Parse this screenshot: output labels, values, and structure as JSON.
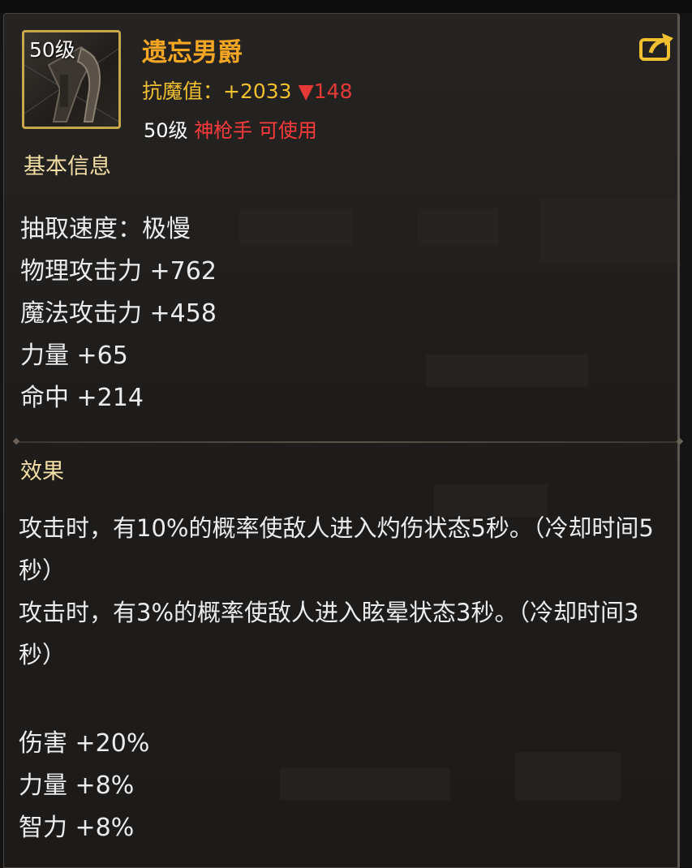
{
  "item": {
    "level_badge": "50级",
    "name": "遗忘男爵",
    "stat_label": "抗魔值：",
    "stat_value": "+2033",
    "stat_delta": "▼148",
    "req_level": "50级",
    "req_class": "神枪手 可使用"
  },
  "basic_info": {
    "title": "基本信息",
    "attributes": [
      "抽取速度：极慢",
      "物理攻击力 +762",
      "魔法攻击力 +458",
      "力量 +65",
      "命中 +214"
    ]
  },
  "effects": {
    "title": "效果",
    "lines": [
      "攻击时，有10%的概率使敌人进入灼伤状态5秒。（冷却时间5秒）",
      "攻击时，有3%的概率使敌人进入眩晕状态3秒。（冷却时间3秒）"
    ],
    "bonuses": [
      "伤害 +20%",
      "力量 +8%",
      "智力 +8%"
    ]
  },
  "icons": {
    "share": "share-arrow-icon",
    "item": "weapon-icon"
  },
  "colors": {
    "name": "#f5a623",
    "stat": "#f0c030",
    "delta_down": "#e53935",
    "class_req": "#ff3b3b",
    "section_title": "#f3dfa5",
    "icon_border": "#c9a84c"
  }
}
